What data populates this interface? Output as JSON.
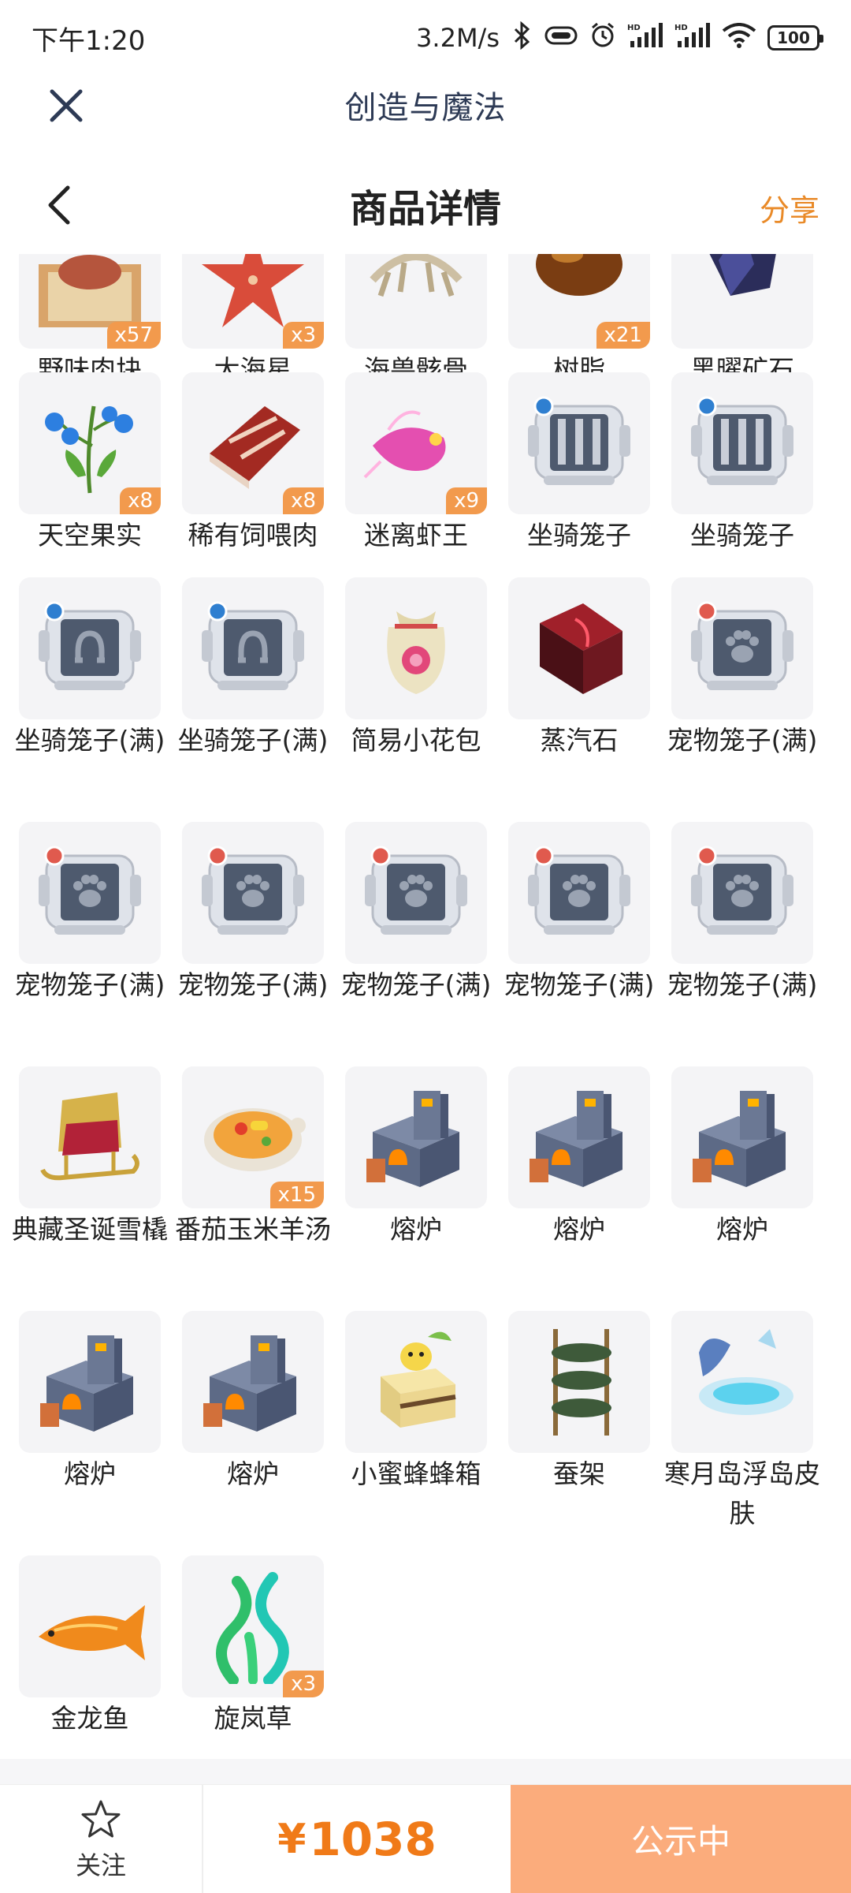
{
  "status_bar": {
    "time": "下午1:20",
    "speed": "3.2M/s",
    "battery": "100",
    "icons": [
      "bluetooth-icon",
      "vibrate-icon",
      "alarm-icon",
      "signal-hd-icon",
      "signal-hd-icon",
      "wifi-icon",
      "battery-icon"
    ]
  },
  "webview": {
    "title": "创造与魔法",
    "close_icon": "close-icon"
  },
  "header": {
    "title": "商品详情",
    "share_label": "分享",
    "back_icon": "chevron-left-icon"
  },
  "items": [
    {
      "name": "野味肉块",
      "qty": "x57",
      "icon": "game-meat-icon"
    },
    {
      "name": "大海星",
      "qty": "x3",
      "icon": "starfish-icon"
    },
    {
      "name": "海兽骸骨",
      "qty": "",
      "icon": "bones-icon"
    },
    {
      "name": "树脂",
      "qty": "x21",
      "icon": "resin-icon"
    },
    {
      "name": "黑曜矿石",
      "qty": "",
      "icon": "obsidian-ore-icon"
    },
    {
      "name": "天空果实",
      "qty": "x8",
      "icon": "sky-fruit-icon"
    },
    {
      "name": "稀有饲喂肉",
      "qty": "x8",
      "icon": "rare-meat-icon"
    },
    {
      "name": "迷离虾王",
      "qty": "x9",
      "icon": "shrimp-king-icon"
    },
    {
      "name": "坐骑笼子",
      "qty": "",
      "icon": "mount-cage-icon"
    },
    {
      "name": "坐骑笼子",
      "qty": "",
      "icon": "mount-cage-icon"
    },
    {
      "name": "坐骑笼子(满)",
      "qty": "",
      "icon": "mount-cage-full-icon"
    },
    {
      "name": "坐骑笼子(满)",
      "qty": "",
      "icon": "mount-cage-full-icon"
    },
    {
      "name": "简易小花包",
      "qty": "",
      "icon": "flower-bag-icon"
    },
    {
      "name": "蒸汽石",
      "qty": "",
      "icon": "steam-stone-icon"
    },
    {
      "name": "宠物笼子(满)",
      "qty": "",
      "icon": "pet-cage-icon"
    },
    {
      "name": "宠物笼子(满)",
      "qty": "",
      "icon": "pet-cage-icon"
    },
    {
      "name": "宠物笼子(满)",
      "qty": "",
      "icon": "pet-cage-icon"
    },
    {
      "name": "宠物笼子(满)",
      "qty": "",
      "icon": "pet-cage-icon"
    },
    {
      "name": "宠物笼子(满)",
      "qty": "",
      "icon": "pet-cage-icon"
    },
    {
      "name": "宠物笼子(满)",
      "qty": "",
      "icon": "pet-cage-icon"
    },
    {
      "name": "典藏圣诞雪橇",
      "qty": "",
      "icon": "christmas-sleigh-icon"
    },
    {
      "name": "番茄玉米羊汤",
      "qty": "x15",
      "icon": "soup-icon"
    },
    {
      "name": "熔炉",
      "qty": "",
      "icon": "furnace-icon"
    },
    {
      "name": "熔炉",
      "qty": "",
      "icon": "furnace-icon"
    },
    {
      "name": "熔炉",
      "qty": "",
      "icon": "furnace-icon"
    },
    {
      "name": "熔炉",
      "qty": "",
      "icon": "furnace-icon"
    },
    {
      "name": "熔炉",
      "qty": "",
      "icon": "furnace-icon"
    },
    {
      "name": "小蜜蜂蜂箱",
      "qty": "",
      "icon": "beehive-icon"
    },
    {
      "name": "蚕架",
      "qty": "",
      "icon": "silkworm-rack-icon"
    },
    {
      "name": "寒月岛浮岛皮肤",
      "qty": "",
      "icon": "floating-island-icon"
    },
    {
      "name": "金龙鱼",
      "qty": "",
      "icon": "arowana-icon"
    },
    {
      "name": "旋岚草",
      "qty": "x3",
      "icon": "whirl-grass-icon"
    }
  ],
  "bottom_bar": {
    "follow_label": "关注",
    "price_currency": "¥",
    "price_value": "1038",
    "status_label": "公示中"
  },
  "colors": {
    "accent": "#f07a18",
    "qty_badge": "#f29a4d",
    "status_button": "#fbac7c",
    "thumb_bg": "#f4f4f6"
  }
}
